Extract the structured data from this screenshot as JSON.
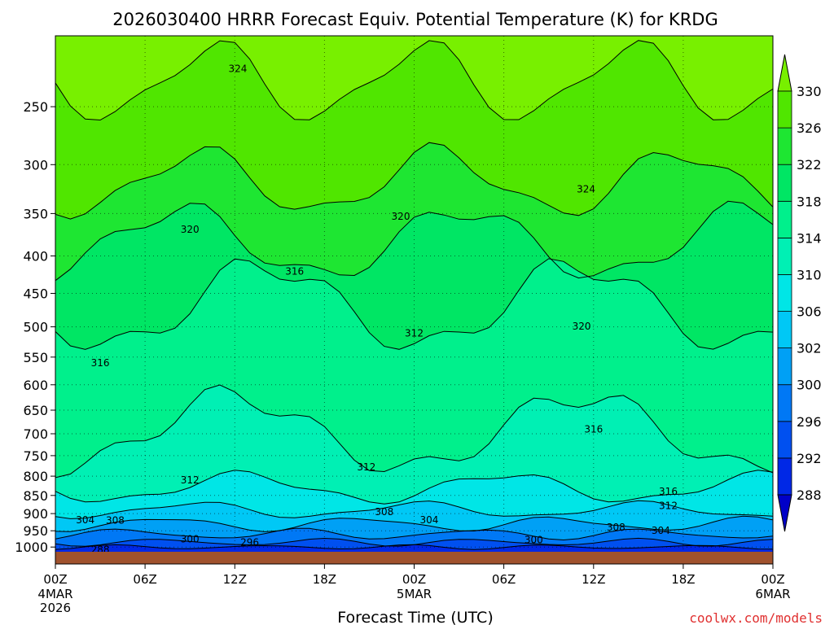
{
  "chart_data": {
    "type": "heatmap",
    "title": "2026030400 HRRR Forecast Equiv. Potential Temperature (K) for KRDG",
    "xlabel": "Forecast Time (UTC)",
    "ylabel": "",
    "credit": "coolwx.com/models",
    "x_ticks": [
      {
        "hour": 0,
        "label": "00Z",
        "sub": [
          "4MAR",
          "2026"
        ]
      },
      {
        "hour": 6,
        "label": "06Z",
        "sub": []
      },
      {
        "hour": 12,
        "label": "12Z",
        "sub": []
      },
      {
        "hour": 18,
        "label": "18Z",
        "sub": []
      },
      {
        "hour": 24,
        "label": "00Z",
        "sub": [
          "5MAR"
        ]
      },
      {
        "hour": 30,
        "label": "06Z",
        "sub": []
      },
      {
        "hour": 36,
        "label": "12Z",
        "sub": []
      },
      {
        "hour": 42,
        "label": "18Z",
        "sub": []
      },
      {
        "hour": 48,
        "label": "00Z",
        "sub": [
          "6MAR"
        ]
      }
    ],
    "x_range": [
      0,
      48
    ],
    "y_ticks": [
      250,
      300,
      350,
      400,
      450,
      500,
      550,
      600,
      650,
      700,
      750,
      800,
      850,
      900,
      950,
      1000
    ],
    "y_range": [
      200,
      1015
    ],
    "y_scale": "log",
    "colorbar": {
      "levels": [
        288,
        292,
        296,
        300,
        302,
        306,
        310,
        314,
        318,
        322,
        326,
        330
      ],
      "colors": [
        "#0000c8",
        "#0028e6",
        "#0050f0",
        "#0078f5",
        "#00a0f5",
        "#00c8f5",
        "#00e6e6",
        "#00f0b4",
        "#00f08c",
        "#00e664",
        "#1ee632",
        "#50e600",
        "#78f000"
      ]
    },
    "contour_labels": [
      {
        "text": "324",
        "hour": 12.2,
        "p": 222
      },
      {
        "text": "324",
        "hour": 35.5,
        "p": 324
      },
      {
        "text": "320",
        "hour": 9.0,
        "p": 368
      },
      {
        "text": "320",
        "hour": 23.1,
        "p": 353
      },
      {
        "text": "320",
        "hour": 35.2,
        "p": 499
      },
      {
        "text": "316",
        "hour": 16.0,
        "p": 420
      },
      {
        "text": "316",
        "hour": 3.0,
        "p": 560
      },
      {
        "text": "316",
        "hour": 36.0,
        "p": 690
      },
      {
        "text": "316",
        "hour": 41.0,
        "p": 840
      },
      {
        "text": "312",
        "hour": 24.0,
        "p": 510
      },
      {
        "text": "312",
        "hour": 20.8,
        "p": 778
      },
      {
        "text": "312",
        "hour": 9.0,
        "p": 810
      },
      {
        "text": "312",
        "hour": 41.0,
        "p": 878
      },
      {
        "text": "308",
        "hour": 22.0,
        "p": 895
      },
      {
        "text": "308",
        "hour": 4.0,
        "p": 920
      },
      {
        "text": "308",
        "hour": 37.5,
        "p": 940
      },
      {
        "text": "304",
        "hour": 2.0,
        "p": 918
      },
      {
        "text": "304",
        "hour": 25.0,
        "p": 918
      },
      {
        "text": "304",
        "hour": 40.5,
        "p": 950
      },
      {
        "text": "300",
        "hour": 9.0,
        "p": 975
      },
      {
        "text": "300",
        "hour": 32.0,
        "p": 978
      },
      {
        "text": "296",
        "hour": 13.0,
        "p": 985
      },
      {
        "text": "288",
        "hour": 3.0,
        "p": 1008
      }
    ]
  }
}
